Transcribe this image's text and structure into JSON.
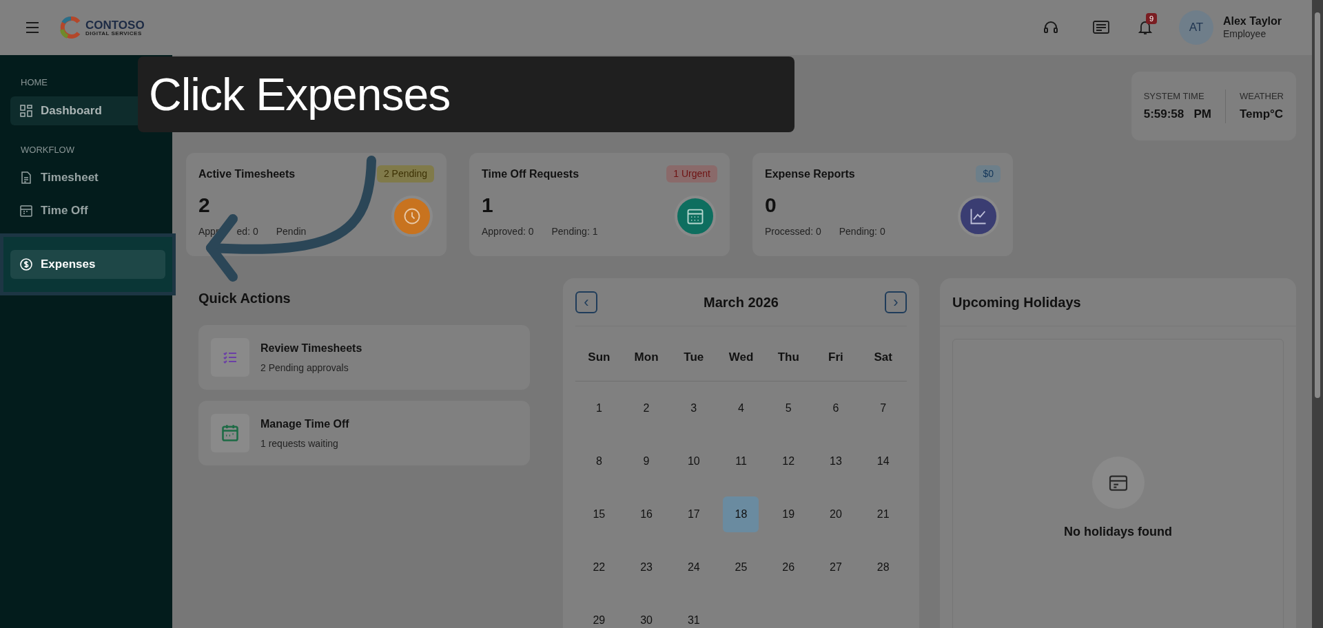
{
  "topbar": {
    "logo": {
      "name": "CONTOSO",
      "tagline": "DIGITAL SERVICES"
    },
    "notification_count": "9",
    "user": {
      "initials": "AT",
      "name": "Alex Taylor",
      "role": "Employee"
    }
  },
  "sidebar": {
    "sections": [
      {
        "heading": "HOME",
        "items": [
          {
            "label": "Dashboard",
            "selected": true,
            "spotlit": false
          }
        ]
      },
      {
        "heading": "WORKFLOW",
        "items": [
          {
            "label": "Timesheet",
            "selected": false,
            "spotlit": false
          },
          {
            "label": "Time Off",
            "selected": false,
            "spotlit": false
          },
          {
            "label": "Expenses",
            "selected": false,
            "spotlit": true
          }
        ]
      }
    ]
  },
  "callout": {
    "text": "Click Expenses"
  },
  "system_info": [
    {
      "label": "SYSTEM TIME",
      "value": "5:59:58   PM"
    },
    {
      "label": "WEATHER",
      "value": "Temp°C"
    }
  ],
  "stats": [
    {
      "title": "Active Timesheets",
      "badge": {
        "text": "2 Pending",
        "color": "#807a4a"
      },
      "value": "2",
      "details": [
        "Appr",
        "ed: 0",
        "Pendin"
      ],
      "color": "#c8731f"
    },
    {
      "title": "Time Off Requests",
      "badge": {
        "text": "1 Urgent",
        "color": "#8a6a6a"
      },
      "value": "1",
      "details": [
        "Approved: 0",
        "Pending: 1"
      ],
      "color": "#0e6e5f"
    },
    {
      "title": "Expense Reports",
      "badge": {
        "text": "$0",
        "color": "#6d7f8a"
      },
      "value": "0",
      "details": [
        "Processed: 0",
        "Pending: 0"
      ],
      "color": "#3a3d72"
    }
  ],
  "quick_actions": {
    "title": "Quick Actions",
    "items": [
      {
        "title": "Review Timesheets",
        "subtitle": "2 Pending approvals",
        "color": "#6b3fa6"
      },
      {
        "title": "Manage Time Off",
        "subtitle": "1 requests waiting",
        "color": "#1d6b45"
      }
    ]
  },
  "calendar": {
    "month": "March 2026",
    "prev": "‹",
    "next": "›",
    "weekdays": [
      "Sun",
      "Mon",
      "Tue",
      "Wed",
      "Thu",
      "Fri",
      "Sat"
    ],
    "days": [
      {
        "day": "1",
        "selected": false
      },
      {
        "day": "2",
        "selected": false
      },
      {
        "day": "3",
        "selected": false
      },
      {
        "day": "4",
        "selected": false
      },
      {
        "day": "5",
        "selected": false
      },
      {
        "day": "6",
        "selected": false
      },
      {
        "day": "7",
        "selected": false
      },
      {
        "day": "8",
        "selected": false
      },
      {
        "day": "9",
        "selected": false
      },
      {
        "day": "10",
        "selected": false
      },
      {
        "day": "11",
        "selected": false
      },
      {
        "day": "12",
        "selected": false
      },
      {
        "day": "13",
        "selected": false
      },
      {
        "day": "14",
        "selected": false
      },
      {
        "day": "15",
        "selected": false
      },
      {
        "day": "16",
        "selected": false
      },
      {
        "day": "17",
        "selected": false
      },
      {
        "day": "18",
        "selected": true
      },
      {
        "day": "19",
        "selected": false
      },
      {
        "day": "20",
        "selected": false
      },
      {
        "day": "21",
        "selected": false
      },
      {
        "day": "22",
        "selected": false
      },
      {
        "day": "23",
        "selected": false
      },
      {
        "day": "24",
        "selected": false
      },
      {
        "day": "25",
        "selected": false
      },
      {
        "day": "26",
        "selected": false
      },
      {
        "day": "27",
        "selected": false
      },
      {
        "day": "28",
        "selected": false
      },
      {
        "day": "29",
        "selected": false
      },
      {
        "day": "30",
        "selected": false
      },
      {
        "day": "31",
        "selected": false
      }
    ]
  },
  "holidays": {
    "title": "Upcoming Holidays",
    "empty_text": "No holidays found"
  }
}
